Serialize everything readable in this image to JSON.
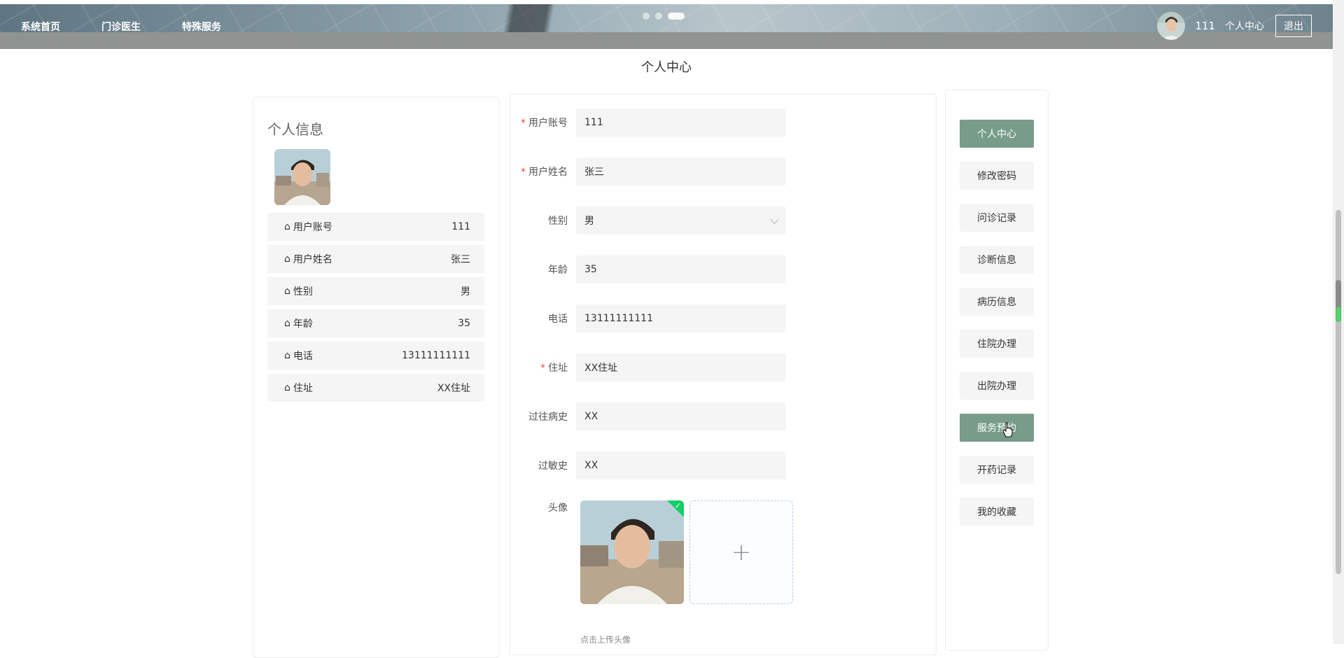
{
  "header": {
    "nav_items": [
      {
        "label": "系统首页"
      },
      {
        "label": "门诊医生"
      },
      {
        "label": "特殊服务"
      }
    ],
    "carousel_dots": 3,
    "username": "111",
    "user_center": "个人中心",
    "logout": "退出"
  },
  "page": {
    "title": "个人中心"
  },
  "profile_panel": {
    "title": "个人信息",
    "rows": [
      {
        "label": "用户账号",
        "value": "111"
      },
      {
        "label": "用户姓名",
        "value": "张三"
      },
      {
        "label": "性别",
        "value": "男"
      },
      {
        "label": "年龄",
        "value": "35"
      },
      {
        "label": "电话",
        "value": "13111111111"
      },
      {
        "label": "住址",
        "value": "XX住址"
      }
    ]
  },
  "form": {
    "account": {
      "label": "用户账号",
      "value": "111",
      "required": true
    },
    "name": {
      "label": "用户姓名",
      "value": "张三",
      "required": true
    },
    "gender": {
      "label": "性别",
      "value": "男"
    },
    "age": {
      "label": "年龄",
      "value": "35"
    },
    "phone": {
      "label": "电话",
      "value": "13111111111"
    },
    "address": {
      "label": "住址",
      "value": "XX住址",
      "required": true
    },
    "history": {
      "label": "过往病史",
      "value": "XX"
    },
    "allergy": {
      "label": "过敏史",
      "value": "XX"
    },
    "avatar": {
      "label": "头像",
      "tip": "点击上传头像",
      "add_symbol": "+"
    }
  },
  "side_menu": {
    "items": [
      {
        "label": "个人中心",
        "active": true
      },
      {
        "label": "修改密码",
        "active": false
      },
      {
        "label": "问诊记录",
        "active": false
      },
      {
        "label": "诊断信息",
        "active": false
      },
      {
        "label": "病历信息",
        "active": false
      },
      {
        "label": "住院办理",
        "active": false
      },
      {
        "label": "出院办理",
        "active": false
      },
      {
        "label": "服务预约",
        "active": true
      },
      {
        "label": "开药记录",
        "active": false
      },
      {
        "label": "我的收藏",
        "active": false
      }
    ]
  },
  "colors": {
    "accent": "#779c8a",
    "required": "#e74c3c",
    "upload_success": "#13ce66"
  }
}
